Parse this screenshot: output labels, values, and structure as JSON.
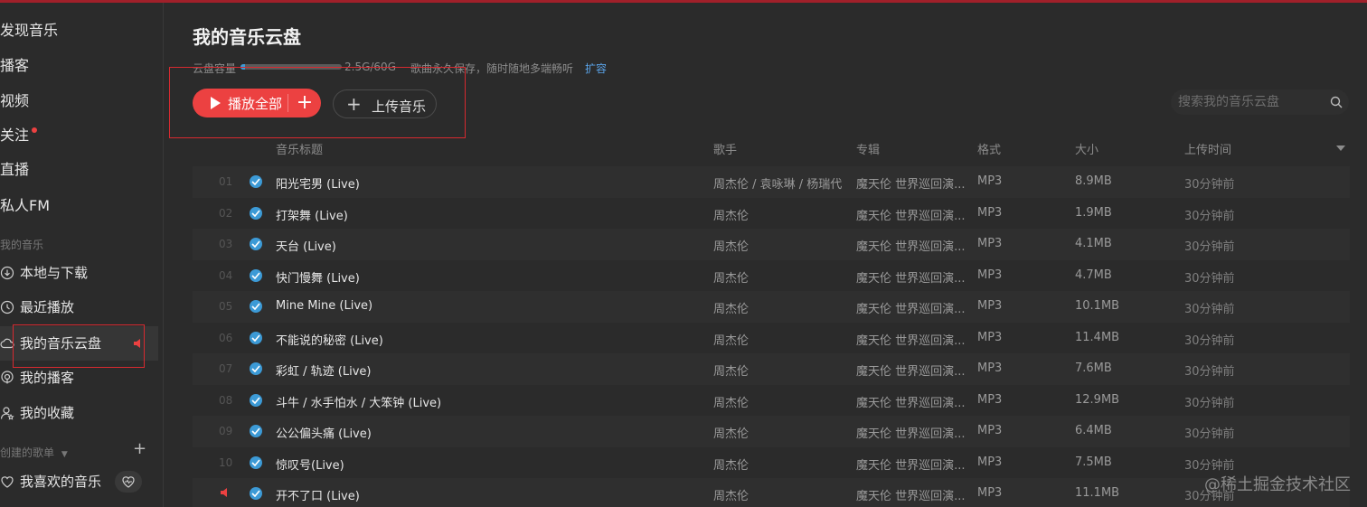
{
  "sidebar": {
    "discover": "发现音乐",
    "podcast": "播客",
    "video": "视频",
    "follow": "关注",
    "live": "直播",
    "fm": "私人FM",
    "my_music_label": "我的音乐",
    "my_items": [
      {
        "label": "本地与下载",
        "icon": "download-icon"
      },
      {
        "label": "最近播放",
        "icon": "clock-icon"
      },
      {
        "label": "我的音乐云盘",
        "icon": "cloud-icon"
      },
      {
        "label": "我的播客",
        "icon": "podcast-icon"
      },
      {
        "label": "我的收藏",
        "icon": "user-star-icon"
      }
    ],
    "created_playlists_label": "创建的歌单",
    "liked_music": "我喜欢的音乐"
  },
  "main": {
    "title": "我的音乐云盘",
    "capacity_label": "云盘容量",
    "capacity_used_fraction": 0.0417,
    "capacity_text": "2.5G/60G",
    "capacity_note": "歌曲永久保存，随时随地多端畅听",
    "expand_link": "扩容",
    "play_all": "播放全部",
    "upload": "上传音乐",
    "search_placeholder": "搜索我的音乐云盘"
  },
  "table": {
    "headers": {
      "title": "音乐标题",
      "artist": "歌手",
      "album": "专辑",
      "format": "格式",
      "size": "大小",
      "uploaded": "上传时间"
    },
    "rows": [
      {
        "idx": "01",
        "title": "阳光宅男 (Live)",
        "artist": "周杰伦 / 袁咏琳 / 杨瑞代",
        "album": "魔天伦 世界巡回演...",
        "format": "MP3",
        "size": "8.9MB",
        "time": "30分钟前"
      },
      {
        "idx": "02",
        "title": "打架舞 (Live)",
        "artist": "周杰伦",
        "album": "魔天伦 世界巡回演...",
        "format": "MP3",
        "size": "1.9MB",
        "time": "30分钟前"
      },
      {
        "idx": "03",
        "title": "天台 (Live)",
        "artist": "周杰伦",
        "album": "魔天伦 世界巡回演...",
        "format": "MP3",
        "size": "4.1MB",
        "time": "30分钟前"
      },
      {
        "idx": "04",
        "title": "快门慢舞 (Live)",
        "artist": "周杰伦",
        "album": "魔天伦 世界巡回演...",
        "format": "MP3",
        "size": "4.7MB",
        "time": "30分钟前"
      },
      {
        "idx": "05",
        "title": "Mine Mine (Live)",
        "artist": "周杰伦",
        "album": "魔天伦 世界巡回演...",
        "format": "MP3",
        "size": "10.1MB",
        "time": "30分钟前"
      },
      {
        "idx": "06",
        "title": "不能说的秘密 (Live)",
        "artist": "周杰伦",
        "album": "魔天伦 世界巡回演...",
        "format": "MP3",
        "size": "11.4MB",
        "time": "30分钟前"
      },
      {
        "idx": "07",
        "title": "彩虹 / 轨迹 (Live)",
        "artist": "周杰伦",
        "album": "魔天伦 世界巡回演...",
        "format": "MP3",
        "size": "7.6MB",
        "time": "30分钟前"
      },
      {
        "idx": "08",
        "title": "斗牛 / 水手怕水 / 大笨钟 (Live)",
        "artist": "周杰伦",
        "album": "魔天伦 世界巡回演...",
        "format": "MP3",
        "size": "12.9MB",
        "time": "30分钟前"
      },
      {
        "idx": "09",
        "title": "公公偏头痛 (Live)",
        "artist": "周杰伦",
        "album": "魔天伦 世界巡回演...",
        "format": "MP3",
        "size": "6.4MB",
        "time": "30分钟前"
      },
      {
        "idx": "10",
        "title": "惊叹号(Live)",
        "artist": "周杰伦",
        "album": "魔天伦 世界巡回演...",
        "format": "MP3",
        "size": "7.5MB",
        "time": "30分钟前"
      },
      {
        "idx": "",
        "title": "开不了口 (Live)",
        "artist": "周杰伦",
        "album": "魔天伦 世界巡回演...",
        "format": "MP3",
        "size": "11.1MB",
        "time": "30分钟前",
        "playing": true
      }
    ]
  },
  "watermark": "@稀土掘金技术社区",
  "colors": {
    "accent": "#ec4141",
    "check": "#3c9ad6",
    "background": "#2b2b2b"
  }
}
